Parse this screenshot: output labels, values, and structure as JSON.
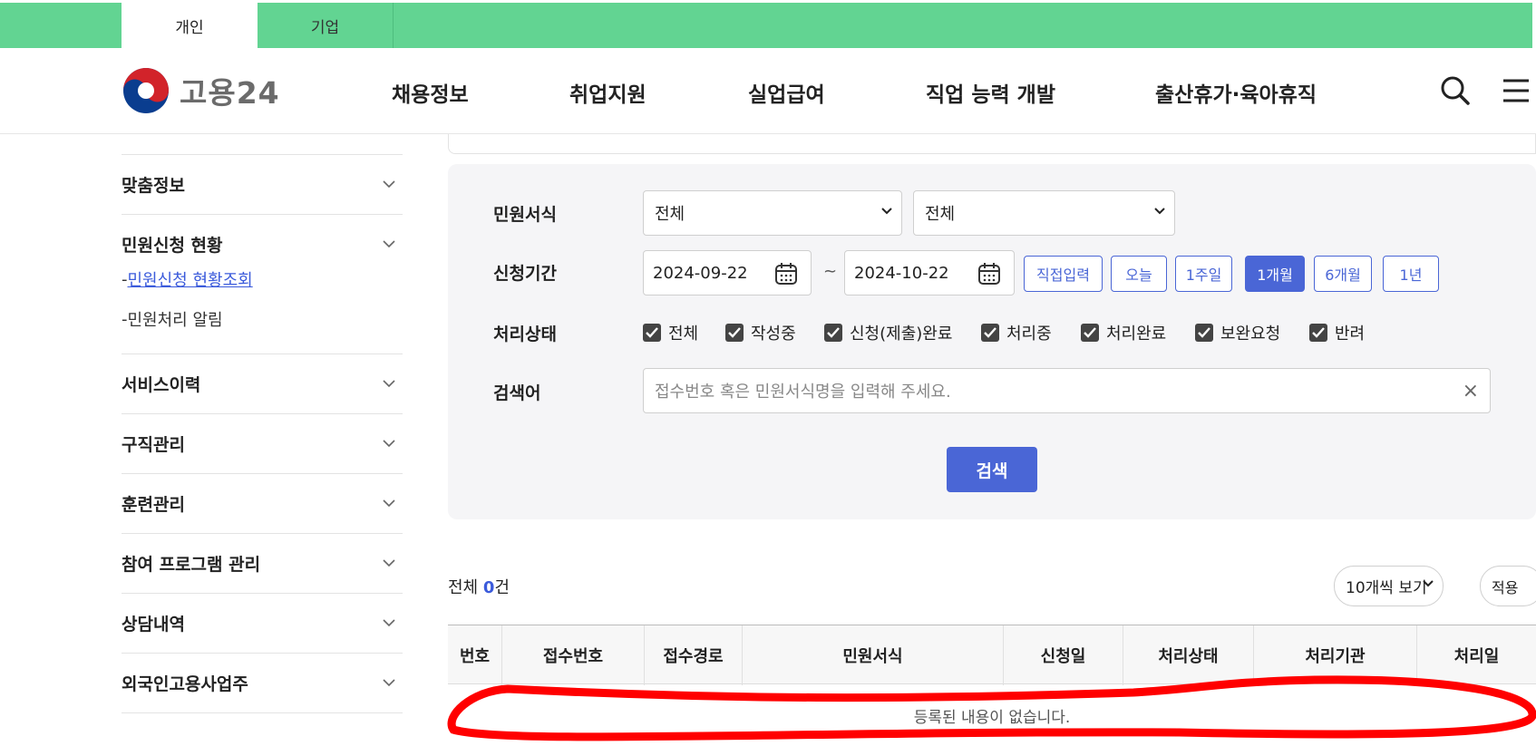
{
  "top_tabs": [
    "개인",
    "기업"
  ],
  "logo": {
    "text": "고용24"
  },
  "gnb": [
    "채용정보",
    "취업지원",
    "실업급여",
    "직업 능력 개발",
    "출산휴가·육아휴직"
  ],
  "header_icons": [
    "search-icon",
    "menu-icon"
  ],
  "sidebar": {
    "sections": [
      {
        "label": "맞춤정보"
      },
      {
        "label": "민원신청 현황",
        "subs": [
          "민원신청 현황조회",
          "민원처리 알림"
        ]
      },
      {
        "label": "서비스이력"
      },
      {
        "label": "구직관리"
      },
      {
        "label": "훈련관리"
      },
      {
        "label": "참여 프로그램 관리"
      },
      {
        "label": "상담내역"
      },
      {
        "label": "외국인고용사업주"
      }
    ]
  },
  "search": {
    "labels": {
      "form": "민원서식",
      "period": "신청기간",
      "status": "처리상태",
      "keyword": "검색어"
    },
    "form_select_1": "전체",
    "form_select_2": "전체",
    "date_from": "2024-09-22",
    "date_tilde": "~",
    "date_to": "2024-10-22",
    "period_buttons": [
      "직접입력",
      "오늘",
      "1주일",
      "1개월",
      "6개월",
      "1년"
    ],
    "period_active": "1개월",
    "status_checkboxes": [
      "전체",
      "작성중",
      "신청(제출)완료",
      "처리중",
      "처리완료",
      "보완요청",
      "반려"
    ],
    "keyword_placeholder": "접수번호 혹은 민원서식명을  입력해 주세요.",
    "clear_symbol": "×",
    "search_button": "검색"
  },
  "results": {
    "total_prefix": "전체 ",
    "total_count": "0",
    "total_suffix": "건",
    "per_page": "10개씩 보기",
    "apply": "적용",
    "columns": [
      "번호",
      "접수번호",
      "접수경로",
      "민원서식",
      "신청일",
      "처리상태",
      "처리기관",
      "처리일"
    ],
    "empty_message": "등록된 내용이 없습니다."
  },
  "colors": {
    "top_bar": "#62d492",
    "accent": "#4a66d6",
    "annotation": "#ff0000"
  }
}
